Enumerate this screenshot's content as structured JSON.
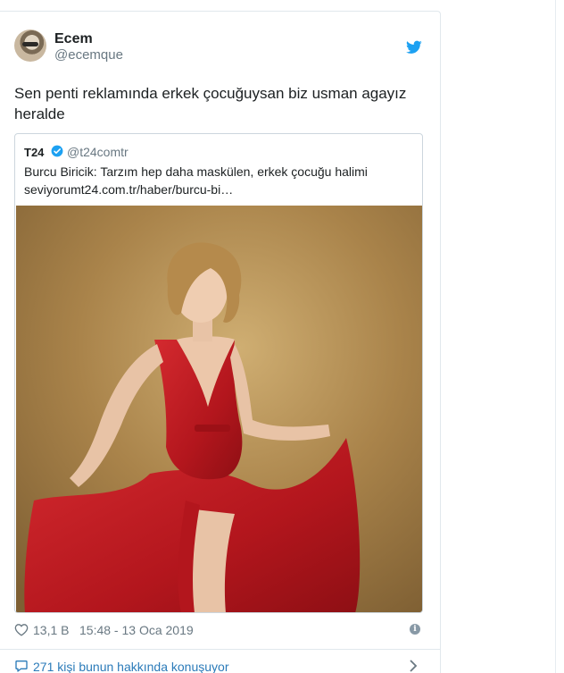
{
  "author": {
    "name": "Ecem",
    "handle": "@ecemque"
  },
  "tweet": {
    "text_line1": "Sen penti reklamında erkek çocuğuysan biz usman agayız",
    "text_line2": "heralde"
  },
  "quoted": {
    "name": "T24",
    "handle": "@t24comtr",
    "text_line1": "Burcu Biricik: Tarzım hep daha maskülen, erkek çocuğu halimi",
    "text_line2": "seviyorumt24.com.tr/haber/burcu-bi…",
    "image": "woman-in-red-gown-photo"
  },
  "meta": {
    "likes": "13,1 B",
    "timestamp": "15:48 - 13 Oca 2019"
  },
  "conversation": {
    "label": "271 kişi bunun hakkında konuşuyor"
  },
  "colors": {
    "twitter_blue": "#1da1f2",
    "link_blue": "#2b7bb9",
    "muted_gray": "#697882",
    "dress_red": "#c01b22"
  },
  "icons": [
    "twitter-bird-icon",
    "verified-badge-icon",
    "heart-icon",
    "info-icon",
    "speech-bubble-icon",
    "chevron-right-icon"
  ]
}
